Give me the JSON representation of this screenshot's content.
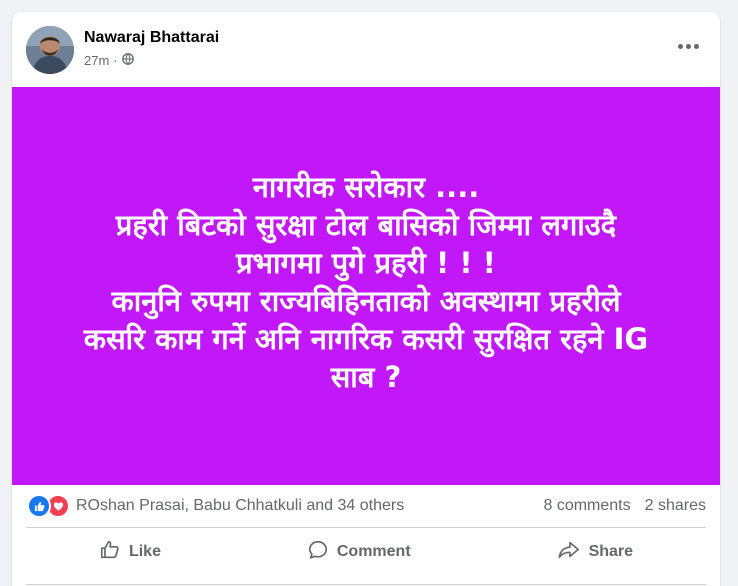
{
  "post": {
    "author": "Nawaraj Bhattarai",
    "time": "27m",
    "separator": "·",
    "privacy_icon": "globe-icon",
    "more_icon": "more-options-icon",
    "image_text_lines": [
      "नागरीक सरोकार ....",
      "प्रहरी बिटको सुरक्षा टोल बासिको जिम्मा लगाउदै",
      "प्रभागमा पुगे प्रहरी ! ! !",
      "कानुनि रुपमा राज्यबिहिनताको अवस्थामा प्रहरीले",
      "कसरि काम गर्ने अनि नागरिक कसरी सुरक्षित रहने IG",
      "साब ?"
    ],
    "image_background": "#c218f9"
  },
  "stats": {
    "reaction_icons": [
      "like-reaction-icon",
      "love-reaction-icon"
    ],
    "reactors": "ROshan Prasai, Babu Chhatkuli and 34 others",
    "comments": "8 comments",
    "shares": "2 shares"
  },
  "actions": {
    "like": "Like",
    "comment": "Comment",
    "share": "Share"
  }
}
